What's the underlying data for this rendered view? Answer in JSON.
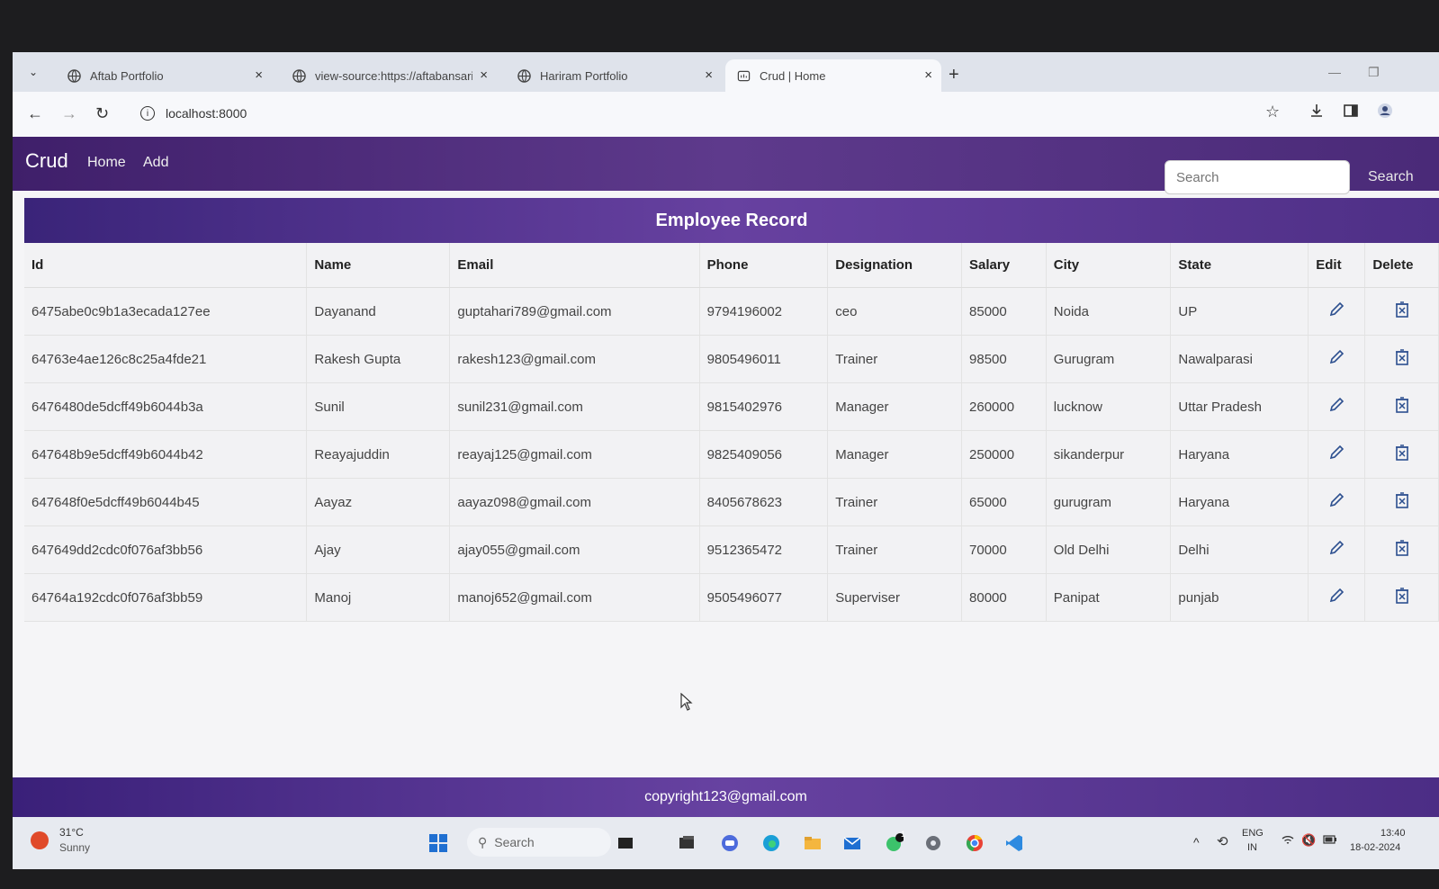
{
  "browser": {
    "tabs": [
      {
        "title": "Aftab Portfolio"
      },
      {
        "title": "view-source:https://aftabansari"
      },
      {
        "title": "Hariram Portfolio"
      },
      {
        "title": "Crud | Home"
      }
    ],
    "url": "localhost:8000"
  },
  "navbar": {
    "brand": "Crud",
    "links": [
      "Home",
      "Add"
    ],
    "search_placeholder": "Search",
    "search_button": "Search"
  },
  "card": {
    "title": "Employee Record"
  },
  "table": {
    "headers": [
      "Id",
      "Name",
      "Email",
      "Phone",
      "Designation",
      "Salary",
      "City",
      "State",
      "Edit",
      "Delete"
    ],
    "rows": [
      {
        "id": "6475abe0c9b1a3ecada127ee",
        "name": "Dayanand",
        "email": "guptahari789@gmail.com",
        "phone": "9794196002",
        "designation": "ceo",
        "salary": "85000",
        "city": "Noida",
        "state": "UP"
      },
      {
        "id": "64763e4ae126c8c25a4fde21",
        "name": "Rakesh Gupta",
        "email": "rakesh123@gmail.com",
        "phone": "9805496011",
        "designation": "Trainer",
        "salary": "98500",
        "city": "Gurugram",
        "state": "Nawalparasi"
      },
      {
        "id": "6476480de5dcff49b6044b3a",
        "name": "Sunil",
        "email": "sunil231@gmail.com",
        "phone": "9815402976",
        "designation": "Manager",
        "salary": "260000",
        "city": "lucknow",
        "state": "Uttar Pradesh"
      },
      {
        "id": "647648b9e5dcff49b6044b42",
        "name": "Reayajuddin",
        "email": "reayaj125@gmail.com",
        "phone": "9825409056",
        "designation": "Manager",
        "salary": "250000",
        "city": "sikanderpur",
        "state": "Haryana"
      },
      {
        "id": "647648f0e5dcff49b6044b45",
        "name": "Aayaz",
        "email": "aayaz098@gmail.com",
        "phone": "8405678623",
        "designation": "Trainer",
        "salary": "65000",
        "city": "gurugram",
        "state": "Haryana"
      },
      {
        "id": "647649dd2cdc0f076af3bb56",
        "name": "Ajay",
        "email": "ajay055@gmail.com",
        "phone": "9512365472",
        "designation": "Trainer",
        "salary": "70000",
        "city": "Old Delhi",
        "state": "Delhi"
      },
      {
        "id": "64764a192cdc0f076af3bb59",
        "name": "Manoj",
        "email": "manoj652@gmail.com",
        "phone": "9505496077",
        "designation": "Superviser",
        "salary": "80000",
        "city": "Panipat",
        "state": "punjab"
      }
    ]
  },
  "footer": {
    "text": "copyright123@gmail.com"
  },
  "taskbar": {
    "weather_temp": "31°C",
    "weather_desc": "Sunny",
    "search_label": "Search",
    "lang_top": "ENG",
    "lang_bottom": "IN",
    "time": "13:40",
    "date": "18-02-2024",
    "notification_count": "1"
  },
  "colors": {
    "navbar": "#4b2a7b",
    "card_header": "#5a3a95",
    "footer": "#5a3a95",
    "edit_icon": "#2c4f8f",
    "delete_icon": "#2c4f8f"
  }
}
